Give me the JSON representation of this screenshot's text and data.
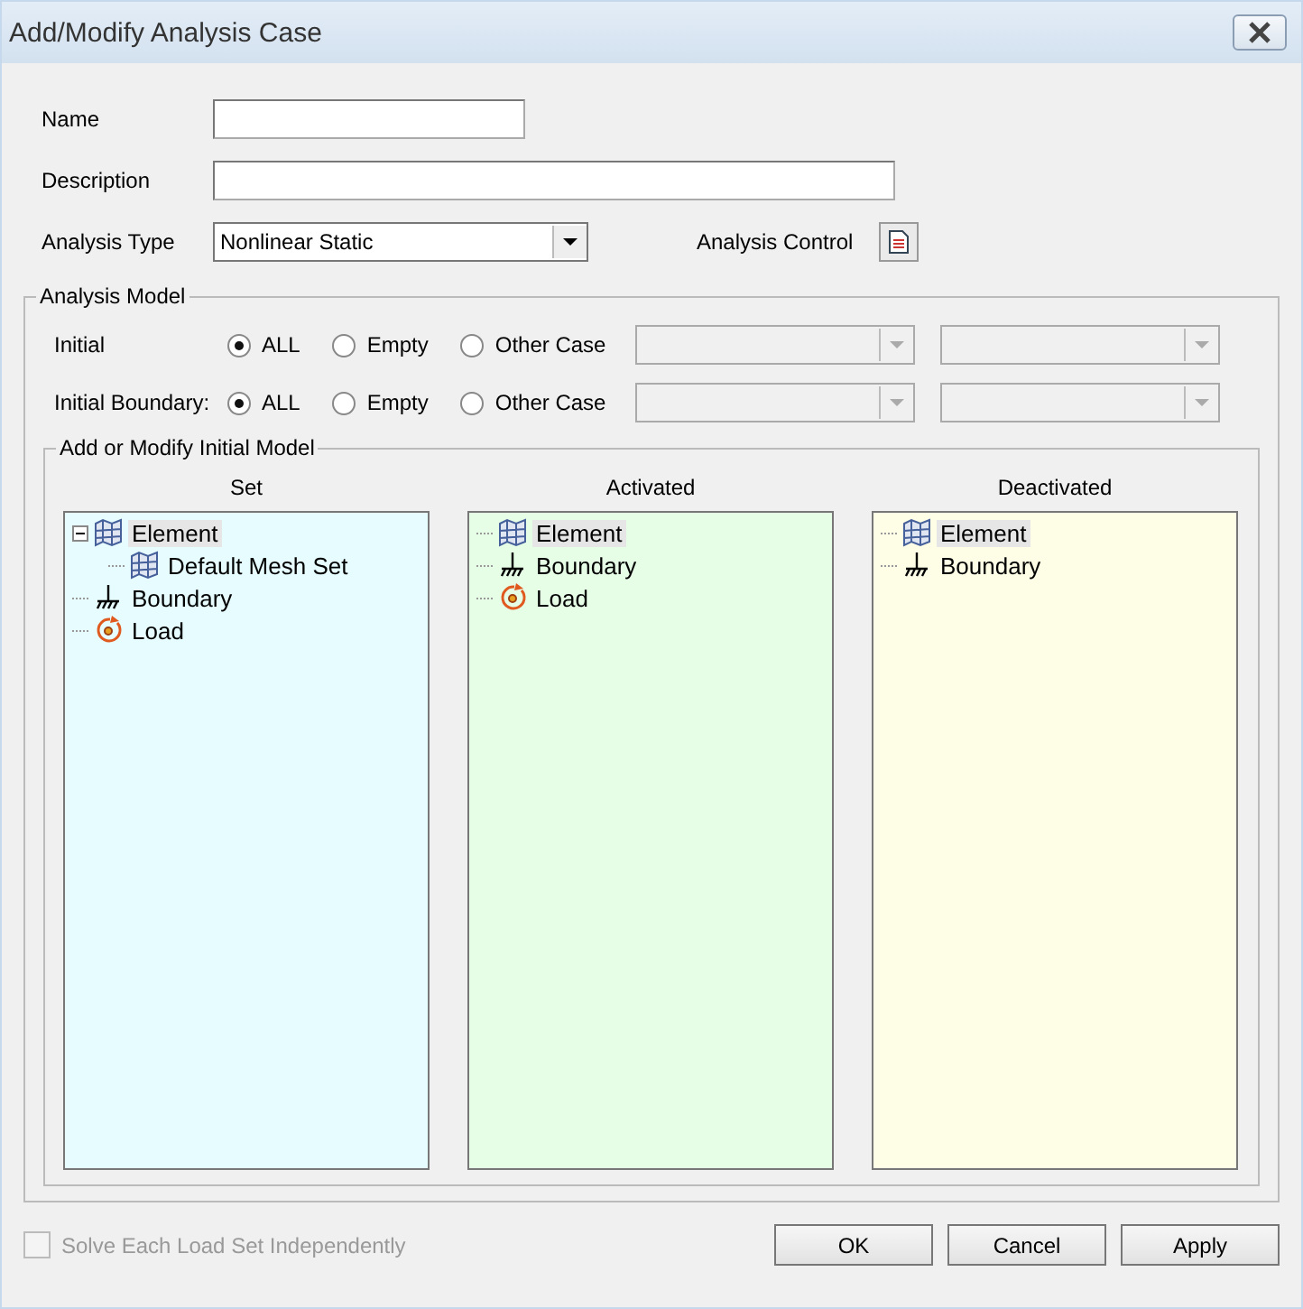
{
  "window": {
    "title": "Add/Modify Analysis Case"
  },
  "name": {
    "label": "Name"
  },
  "description": {
    "label": "Description"
  },
  "analysis_type": {
    "label": "Analysis Type",
    "value": "Nonlinear Static"
  },
  "analysis_control": {
    "label": "Analysis Control"
  },
  "analysis_model": {
    "title": "Analysis Model",
    "rows": [
      {
        "label": "Initial",
        "options": [
          {
            "label": "ALL",
            "selected": true
          },
          {
            "label": "Empty",
            "selected": false
          },
          {
            "label": "Other Case",
            "selected": false
          }
        ],
        "disabled": true
      },
      {
        "label": "Initial Boundary:",
        "options": [
          {
            "label": "ALL",
            "selected": true
          },
          {
            "label": "Empty",
            "selected": false
          },
          {
            "label": "Other Case",
            "selected": false
          }
        ],
        "disabled": true
      }
    ],
    "initial_model": {
      "title": "Add or Modify Initial Model",
      "panels": [
        {
          "title": "Set",
          "color": "#e6fcff",
          "items": [
            {
              "kind": "mesh",
              "label": "Element",
              "selected": true,
              "expanded": true,
              "children": [
                {
                  "kind": "mesh",
                  "label": "Default Mesh Set",
                  "selected": false
                }
              ]
            },
            {
              "kind": "boundary",
              "label": "Boundary",
              "selected": false
            },
            {
              "kind": "load",
              "label": "Load",
              "selected": false
            }
          ]
        },
        {
          "title": "Activated",
          "color": "#e6fde6",
          "items": [
            {
              "kind": "mesh",
              "label": "Element",
              "selected": true
            },
            {
              "kind": "boundary",
              "label": "Boundary",
              "selected": false
            },
            {
              "kind": "load",
              "label": "Load",
              "selected": false
            }
          ]
        },
        {
          "title": "Deactivated",
          "color": "#fefee6",
          "items": [
            {
              "kind": "mesh",
              "label": "Element",
              "selected": true
            },
            {
              "kind": "boundary",
              "label": "Boundary",
              "selected": false
            }
          ]
        }
      ]
    }
  },
  "solve_independently": {
    "label": "Solve Each Load Set Independently",
    "checked": false,
    "disabled": true
  },
  "buttons": [
    "OK",
    "Cancel",
    "Apply"
  ]
}
